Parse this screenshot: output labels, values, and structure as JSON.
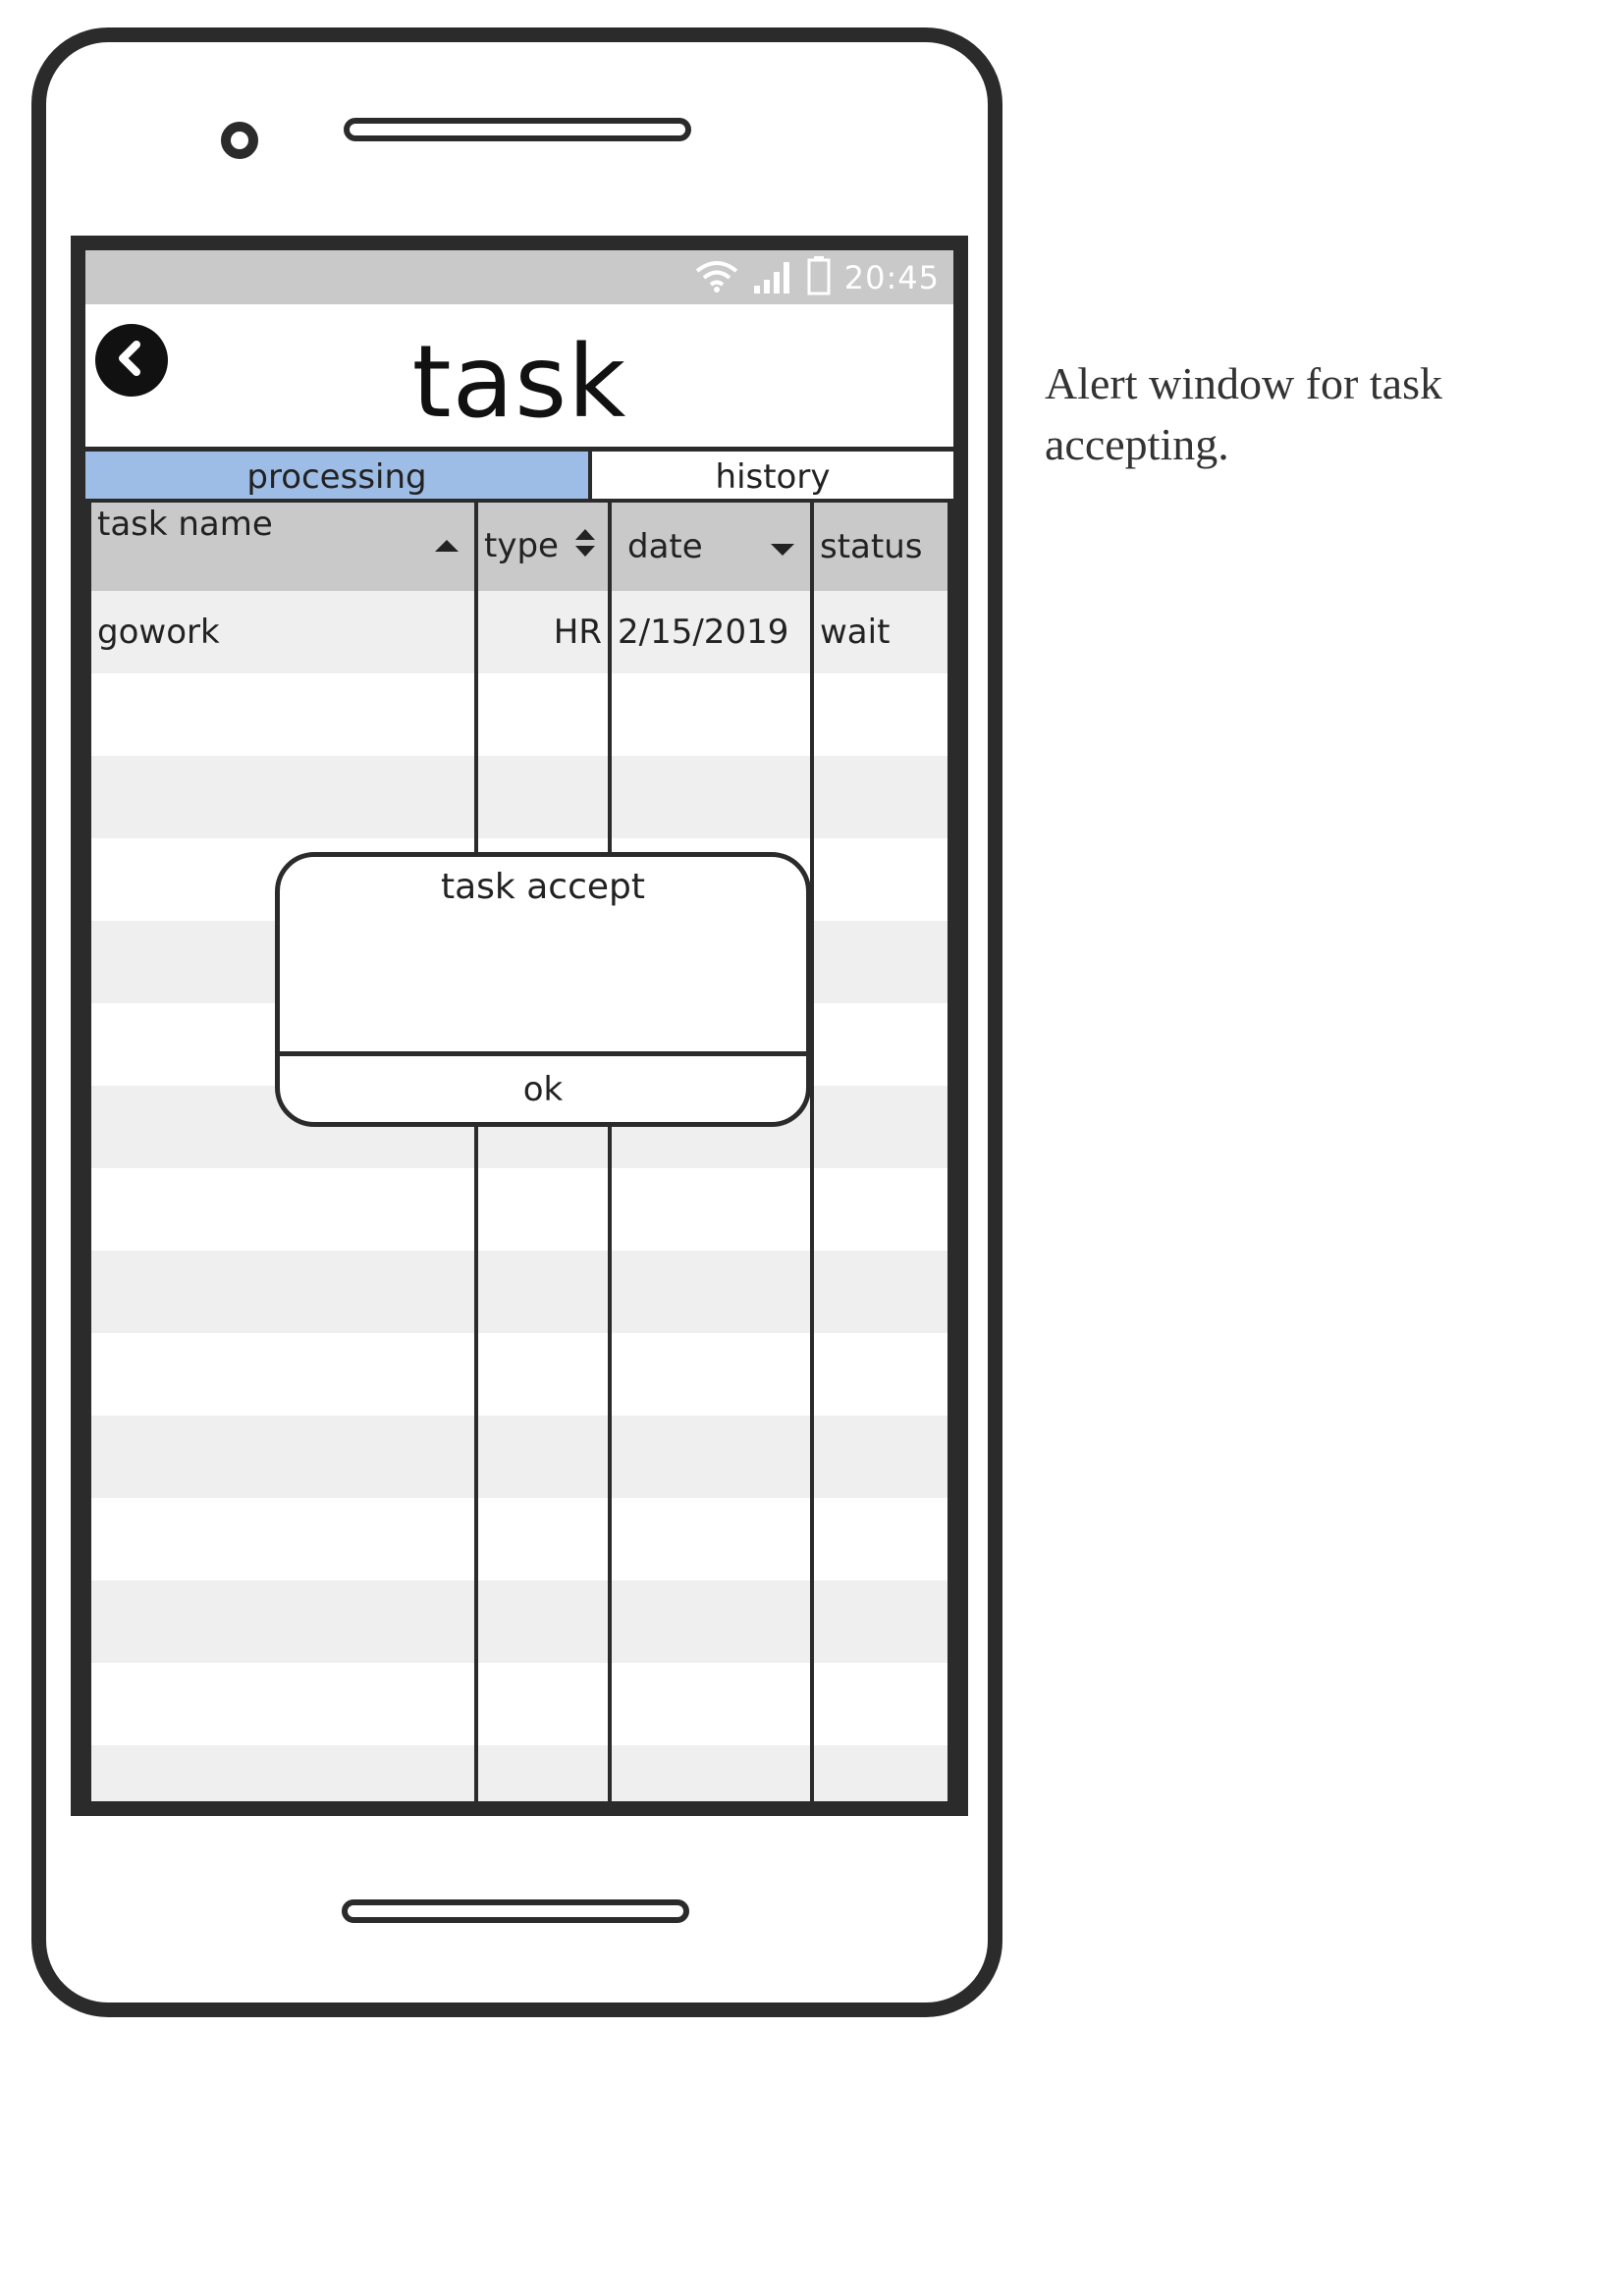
{
  "status_bar": {
    "time": "20:45"
  },
  "app_bar": {
    "title": "task"
  },
  "tabs": [
    {
      "label": "processing",
      "active": true
    },
    {
      "label": "history",
      "active": false
    }
  ],
  "table": {
    "columns": [
      "task name",
      "type",
      "date",
      "status"
    ],
    "rows": [
      [
        "gowork",
        "HR",
        "2/15/2019",
        "wait"
      ]
    ]
  },
  "dialog": {
    "title": "task accept",
    "ok_label": "ok"
  },
  "caption": "Alert window for task accepting.",
  "colors": {
    "active_tab": "#9ebde6",
    "header_bg": "#c9c9c9",
    "status_bar_bg": "#c9c9c9"
  }
}
